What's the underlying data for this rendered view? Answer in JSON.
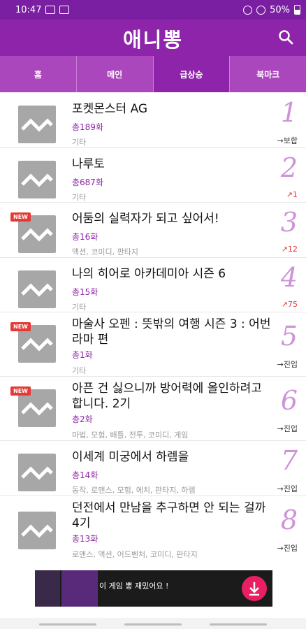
{
  "status_bar": {
    "time": "10:47",
    "battery": "50%"
  },
  "app": {
    "title": "애니뽕"
  },
  "tabs": [
    {
      "label": "홈",
      "active": false
    },
    {
      "label": "메인",
      "active": false
    },
    {
      "label": "급상승",
      "active": true
    },
    {
      "label": "북마크",
      "active": false
    }
  ],
  "items": [
    {
      "title": "포켓몬스터 AG",
      "episodes": "총189화",
      "genre": "기타",
      "rank": "1",
      "change": "→보합",
      "is_new": false,
      "trend": "flat"
    },
    {
      "title": "나루토",
      "episodes": "총687화",
      "genre": "기타",
      "rank": "2",
      "change": "↗1",
      "is_new": false,
      "trend": "up"
    },
    {
      "title": "어둠의 실력자가 되고 싶어서!",
      "episodes": "총16화",
      "genre": "액션, 코미디, 판타지",
      "rank": "3",
      "change": "↗12",
      "is_new": true,
      "trend": "up"
    },
    {
      "title": "나의 히어로 아카데미아 시즌 6",
      "episodes": "총15화",
      "genre": "기타",
      "rank": "4",
      "change": "↗75",
      "is_new": false,
      "trend": "up"
    },
    {
      "title": "마술사 오펜 : 뜻밖의 여행 시즌 3 : 어번라마 편",
      "episodes": "총1화",
      "genre": "기타",
      "rank": "5",
      "change": "→진입",
      "is_new": true,
      "trend": "flat"
    },
    {
      "title": "아픈 건 싫으니까 방어력에 올인하려고 합니다. 2기",
      "episodes": "총2화",
      "genre": "마법, 모험, 배틀, 전투, 코미디, 게임",
      "rank": "6",
      "change": "→진입",
      "is_new": true,
      "trend": "flat"
    },
    {
      "title": "이세계 미궁에서 하렘을",
      "episodes": "총14화",
      "genre": "동작, 로맨스, 모험, 에치, 판타지, 하렘",
      "rank": "7",
      "change": "→진입",
      "is_new": false,
      "trend": "flat"
    },
    {
      "title": "던전에서 만남을 추구하면 안 되는 걸까 4기",
      "episodes": "총13화",
      "genre": "로맨스, 액션, 어드벤처, 코미디, 판타지",
      "rank": "8",
      "change": "→진입",
      "is_new": false,
      "trend": "flat"
    }
  ],
  "new_badge": "NEW",
  "ad": {
    "text": "이 게임 뽕 재밌어요 !"
  },
  "colors": {
    "primary": "#8e24aa",
    "tab_bar": "#ab47bc",
    "rank": "#ce93d8",
    "up": "#e53935"
  }
}
